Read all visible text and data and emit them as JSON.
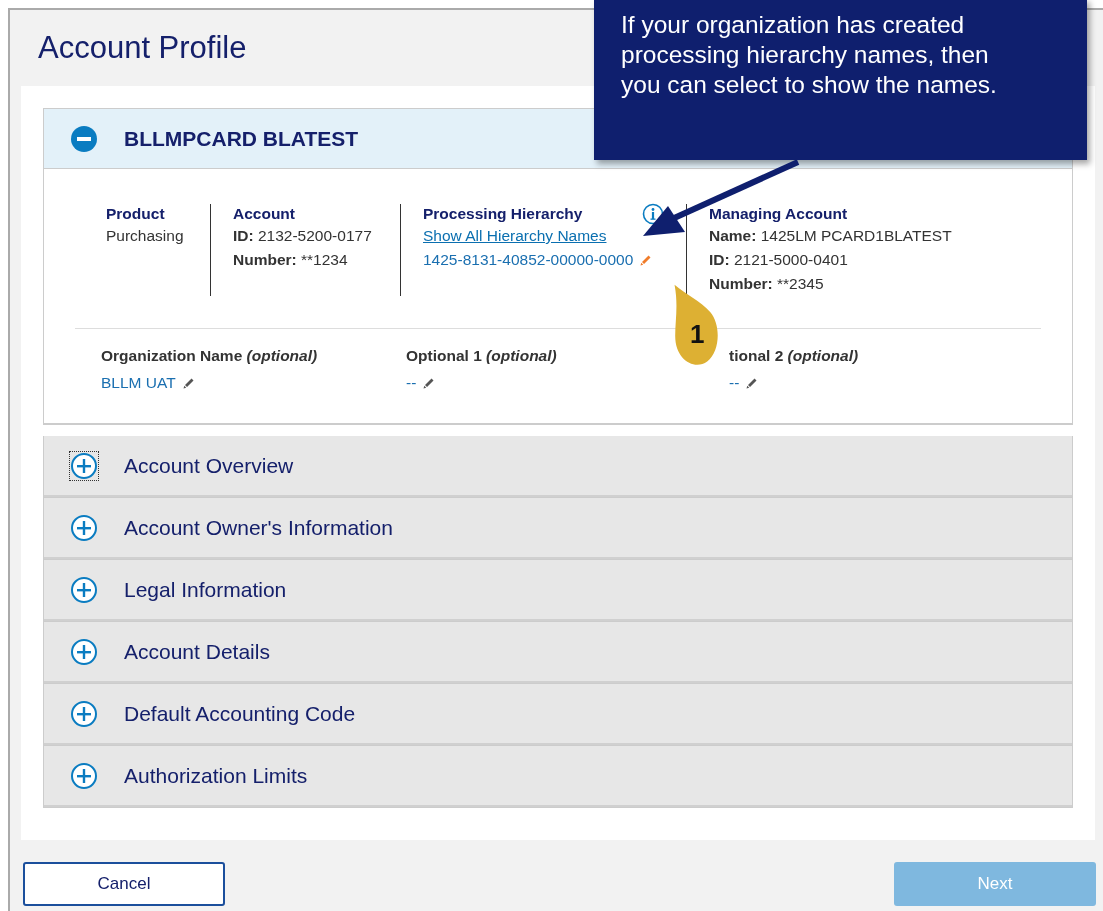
{
  "page": {
    "title": "Account Profile"
  },
  "sections": [
    {
      "title": "BLLMPCARD BLATEST",
      "expanded": true,
      "focused": false,
      "details": {
        "columns": [
          {
            "heading": "Product",
            "info": false,
            "lines": [
              {
                "kind": "text",
                "value": "Purchasing"
              }
            ]
          },
          {
            "heading": "Account",
            "info": false,
            "lines": [
              {
                "kind": "labeled",
                "label": "ID:",
                "value": "2132-5200-0177"
              },
              {
                "kind": "labeled",
                "label": "Number:",
                "value": "**1234"
              }
            ]
          },
          {
            "heading": "Processing Hierarchy",
            "info": true,
            "lines": [
              {
                "kind": "link",
                "value": "Show All Hierarchy Names"
              },
              {
                "kind": "editable",
                "value": "1425-8131-40852-00000-0000",
                "highlighted": true
              }
            ]
          },
          {
            "heading": "Managing Account",
            "info": false,
            "lines": [
              {
                "kind": "labeled",
                "label": "Name:",
                "value": "1425LM PCARD1BLATEST"
              },
              {
                "kind": "labeled",
                "label": "ID:",
                "value": "2121-5000-0401"
              },
              {
                "kind": "labeled",
                "label": "Number:",
                "value": "**2345"
              }
            ]
          }
        ],
        "optional_fields": [
          {
            "label": "Organization Name",
            "hint": "(optional)",
            "value": "BLLM UAT",
            "highlighted": false
          },
          {
            "label": "Optional 1",
            "hint": "(optional)",
            "value": "--",
            "highlighted": false
          },
          {
            "label": "tional 2",
            "hint": "(optional)",
            "value": "--",
            "highlighted": false
          }
        ]
      }
    },
    {
      "title": "Account Overview",
      "expanded": false,
      "focused": true
    },
    {
      "title": "Account Owner's Information",
      "expanded": false,
      "focused": false
    },
    {
      "title": "Legal Information",
      "expanded": false,
      "focused": false
    },
    {
      "title": "Account Details",
      "expanded": false,
      "focused": false
    },
    {
      "title": "Default Accounting Code",
      "expanded": false,
      "focused": false
    },
    {
      "title": "Authorization Limits",
      "expanded": false,
      "focused": false
    }
  ],
  "buttons": [
    {
      "label": "Cancel",
      "kind": "secondary",
      "disabled": false
    },
    {
      "label": "Next",
      "kind": "primary",
      "disabled": true
    }
  ],
  "callout": {
    "text": "If your organization has created processing hierarchy names, then you can select to show the names.",
    "badge": "1"
  }
}
